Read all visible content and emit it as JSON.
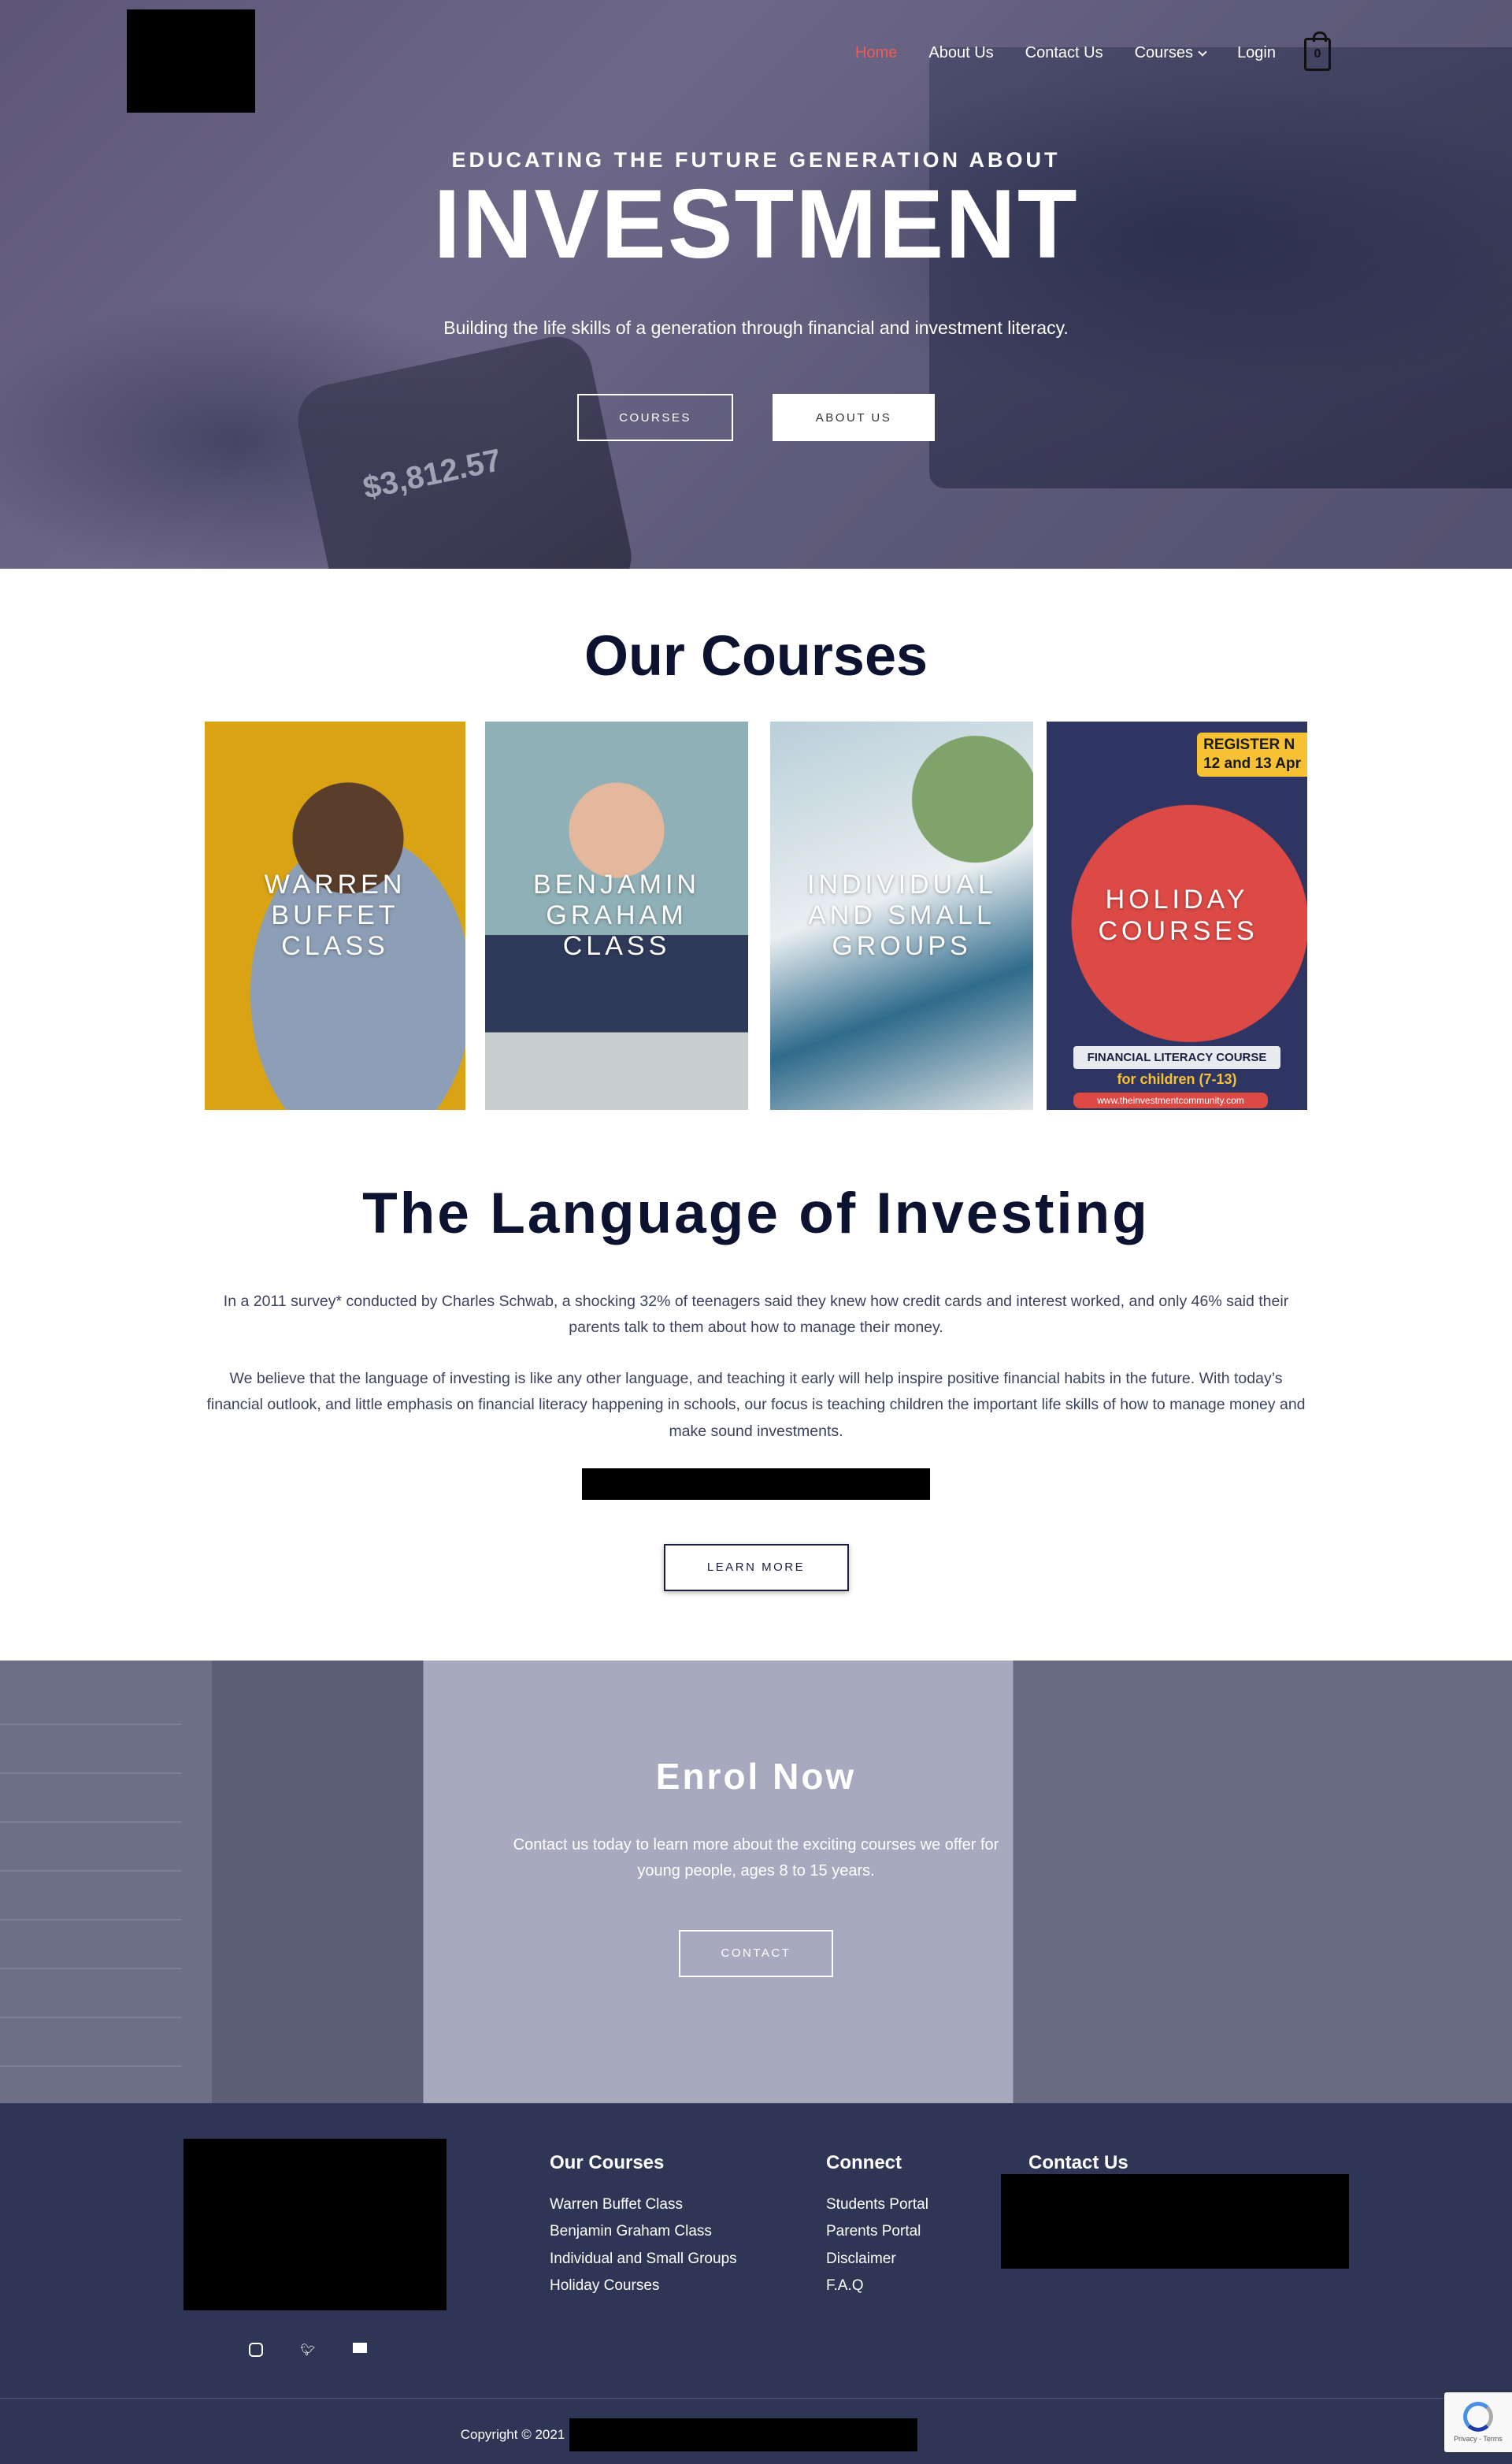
{
  "nav": {
    "items": [
      "Home",
      "About Us",
      "Contact Us",
      "Courses",
      "Login"
    ],
    "cart_count": "0"
  },
  "hero": {
    "phone_text": "$3,812.57",
    "subtitle": "EDUCATING THE FUTURE GENERATION ABOUT",
    "title": "INVESTMENT",
    "description": "Building the life skills of a generation through financial and investment literacy.",
    "btn_courses": "COURSES",
    "btn_about": "ABOUT US"
  },
  "courses": {
    "title": "Our Courses",
    "cards": [
      {
        "label": "WARREN BUFFET CLASS"
      },
      {
        "label": "BENJAMIN GRAHAM CLASS"
      },
      {
        "label": "INDIVIDUAL AND SMALL GROUPS"
      },
      {
        "label": "HOLIDAY COURSES"
      }
    ],
    "holiday_register": "REGISTER N",
    "holiday_dates": "12 and 13 Apr",
    "holiday_badge": "FINANCIAL LITERACY COURSE",
    "holiday_for": "for children (7-13)",
    "holiday_web": "www.theinvestmentcommunity.com"
  },
  "language": {
    "title": "The Language of Investing",
    "p1": "In a 2011 survey* conducted by Charles Schwab, a shocking 32% of teenagers said they knew how credit cards and interest worked, and only 46% said their parents talk to them about how to manage their money.",
    "p2": "We believe that the language of investing is like any other language, and teaching it early will help inspire positive financial habits in the future. With today’s financial outlook, and little emphasis on financial literacy happening in schools, our focus is teaching children the important life skills of how to manage money and make sound investments.",
    "btn": "LEARN MORE"
  },
  "enrol": {
    "title": "Enrol Now",
    "text_line1": "Contact us today to learn more about the exciting courses we offer for",
    "text_line2": "young people, ages 8 to 15 years.",
    "btn": "CONTACT"
  },
  "footer": {
    "col1_title": "Our Courses",
    "col1_links": [
      "Warren Buffet Class",
      "Benjamin Graham Class",
      "Individual and Small Groups",
      "Holiday Courses"
    ],
    "col2_title": "Connect",
    "col2_links": [
      "Students Portal",
      "Parents Portal",
      "Disclaimer",
      "F.A.Q"
    ],
    "col3_title": "Contact Us",
    "copyright": "Copyright © 2021",
    "recaptcha": "Privacy - Terms"
  },
  "colors": {
    "accent_nav": "#ef5a5a",
    "navy": "#0c1331",
    "footer_bg": "#2f3655"
  }
}
